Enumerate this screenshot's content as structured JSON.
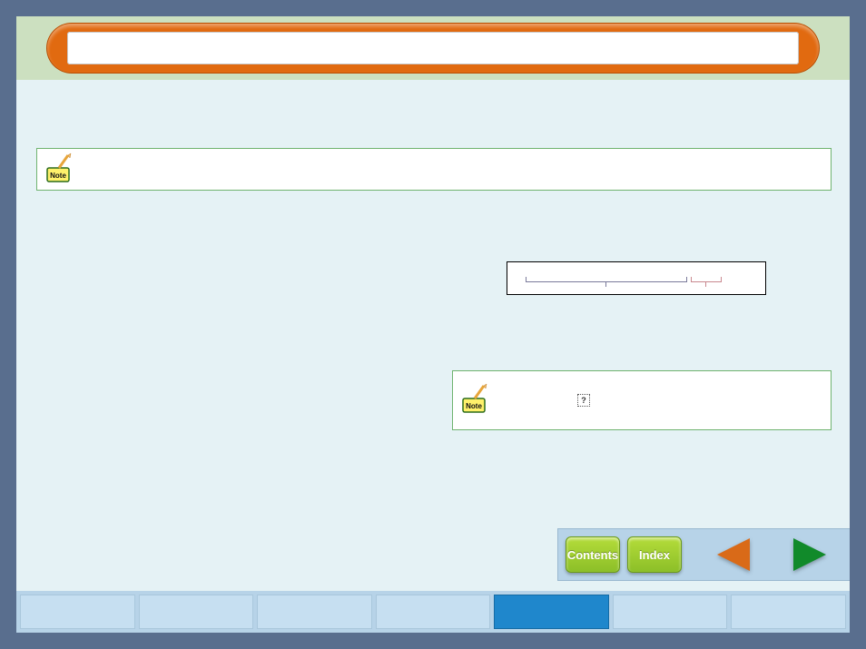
{
  "header": {
    "title": ""
  },
  "notes": {
    "note1_text": "",
    "note2_text": "",
    "help_marker": "?"
  },
  "nav": {
    "contents_label": "Contents",
    "index_label": "Index"
  },
  "tabs": [
    {
      "label": "",
      "active": false
    },
    {
      "label": "",
      "active": false
    },
    {
      "label": "",
      "active": false
    },
    {
      "label": "",
      "active": false
    },
    {
      "label": "",
      "active": true
    },
    {
      "label": "",
      "active": false
    },
    {
      "label": "",
      "active": false
    }
  ],
  "icons": {
    "note_label": "Note"
  }
}
